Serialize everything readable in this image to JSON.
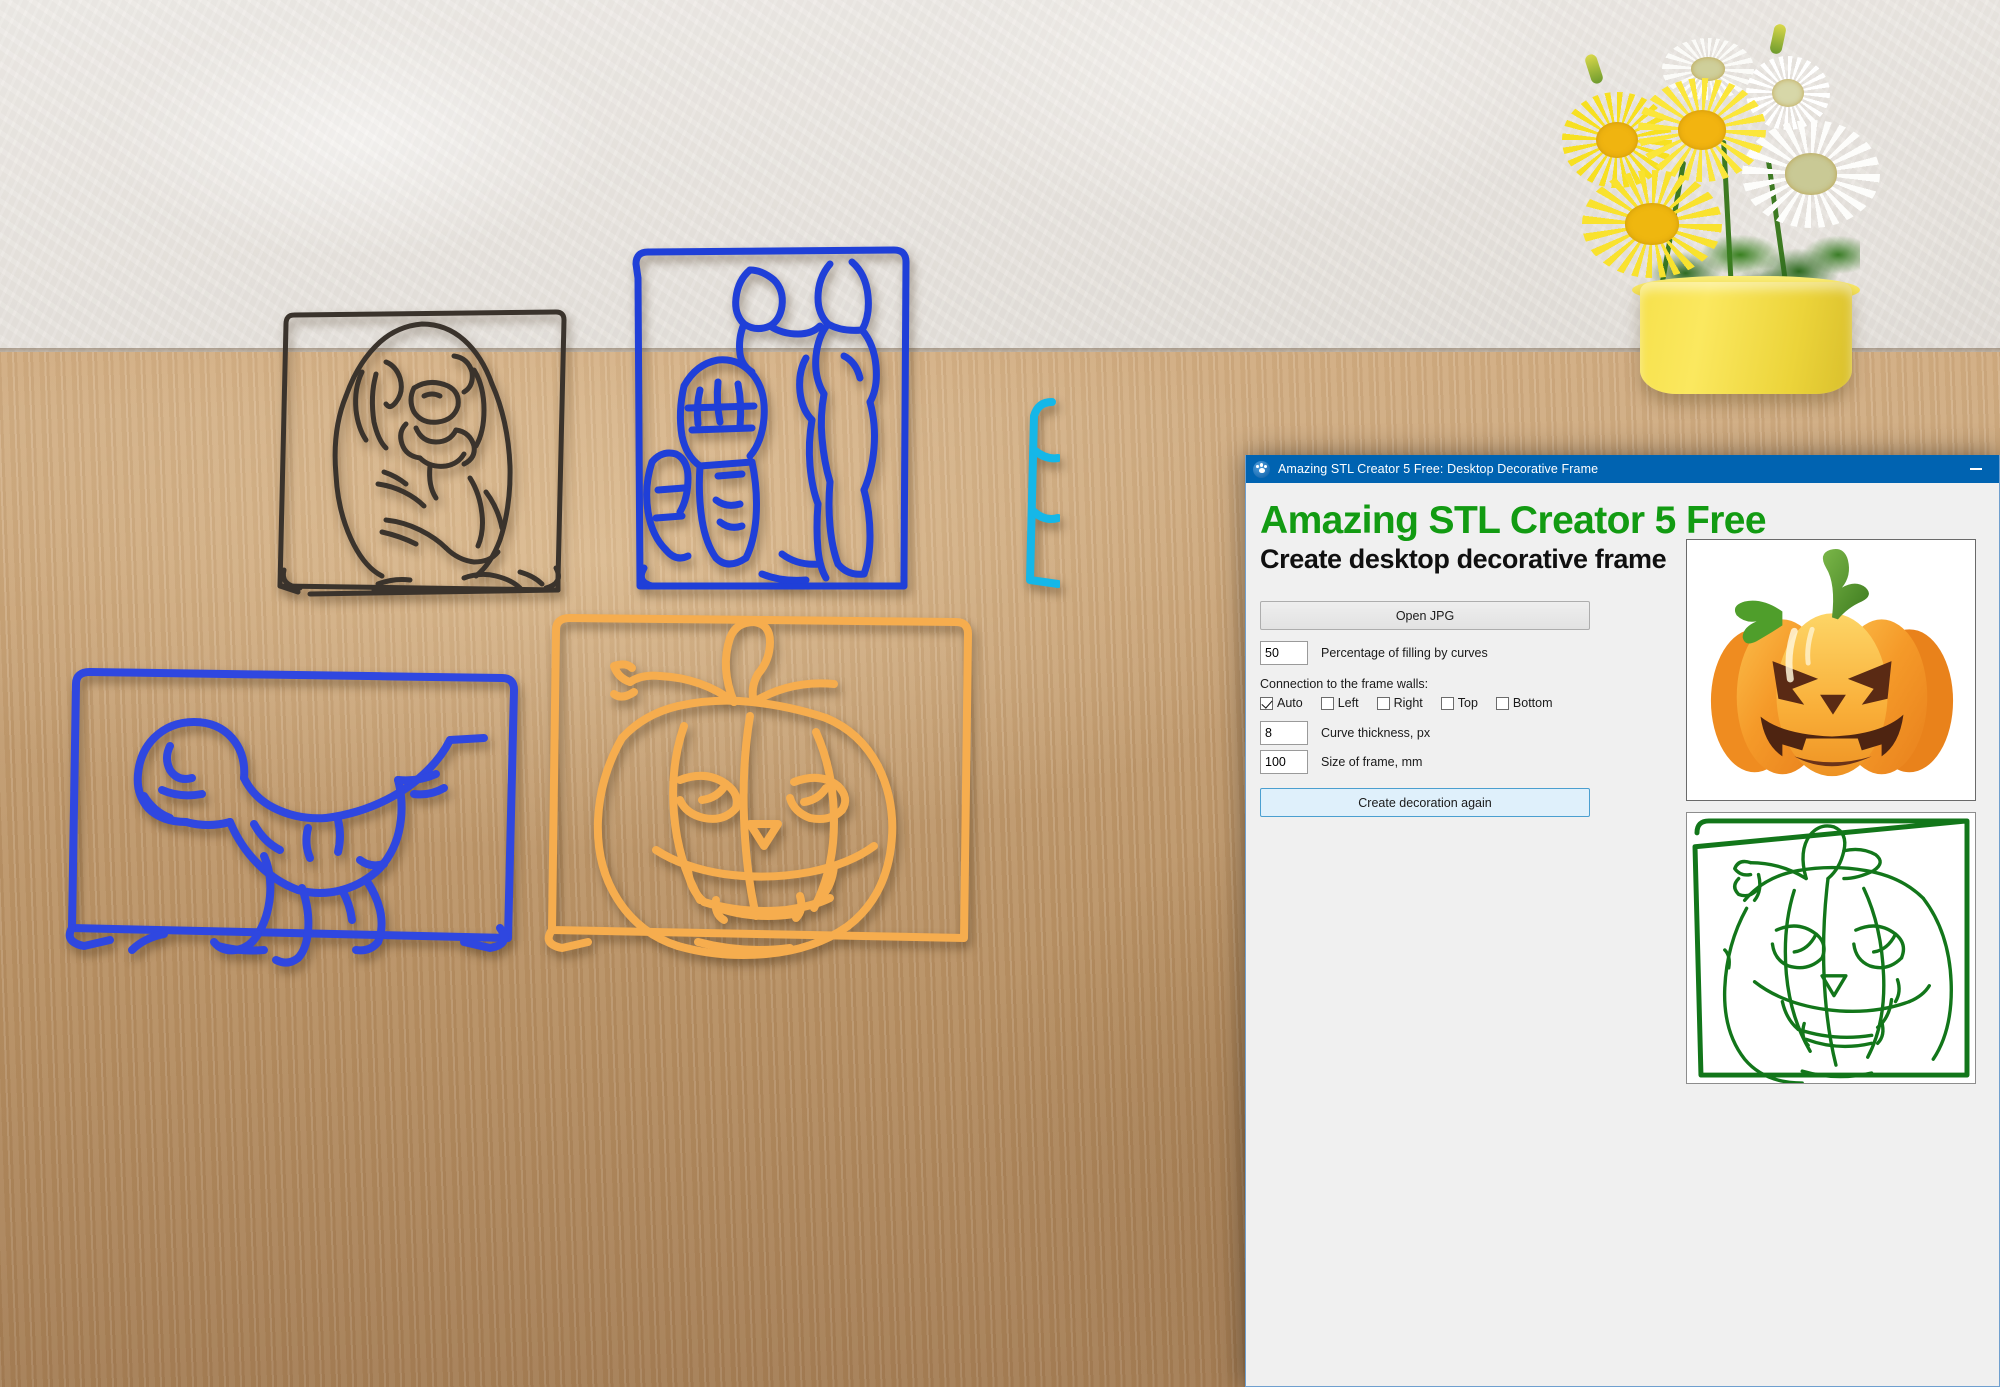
{
  "window": {
    "title": "Amazing STL Creator 5 Free: Desktop Decorative Frame",
    "icon": "paw-app-icon",
    "minimize_label": "Minimize",
    "accent_titlebar_color": "#0063b1",
    "body_color": "#f0f0f0"
  },
  "app": {
    "heading": "Amazing STL Creator 5 Free",
    "heading_color": "#129b12",
    "subheading": "Create desktop decorative frame",
    "subheading_color": "#101010"
  },
  "controls": {
    "open_jpg_label": "Open JPG",
    "percentage": {
      "value": "50",
      "label": "Percentage of filling by curves"
    },
    "connection_section_label": "Connection to the frame walls:",
    "checkboxes": [
      {
        "label": "Auto",
        "checked": true
      },
      {
        "label": "Left",
        "checked": false
      },
      {
        "label": "Right",
        "checked": false
      },
      {
        "label": "Top",
        "checked": false
      },
      {
        "label": "Bottom",
        "checked": false
      }
    ],
    "thickness": {
      "value": "8",
      "label": "Curve thickness, px"
    },
    "framesize": {
      "value": "100",
      "label": "Size of frame, mm"
    },
    "create_again_label": "Create decoration again",
    "create_again_color": "#dff0fb"
  },
  "previews": {
    "source": {
      "name": "source-image-preview",
      "subject": "jack-o-lantern-pumpkin",
      "colors": {
        "body": "#f79a28",
        "body_light": "#fcc košt"
      }
    },
    "output": {
      "name": "vectorized-outline-preview",
      "subject": "jack-o-lantern-outline",
      "stroke_color": "#12761a"
    }
  },
  "photo": {
    "scene": "3d-printed-wire-frames-on-wooden-table",
    "frames": [
      {
        "name": "dog-portrait-frame",
        "color": "#3a332c"
      },
      {
        "name": "star-wars-droids-frame",
        "color": "#1f3fd8"
      },
      {
        "name": "cyan-frame-partial",
        "color": "#15b7e8"
      },
      {
        "name": "trex-dinosaur-frame",
        "color": "#2f47e0"
      },
      {
        "name": "pumpkin-frame",
        "color": "#f6b košt"
      }
    ],
    "plant": {
      "name": "daisy-flowerpot",
      "pot_color": "#f3de46"
    }
  }
}
